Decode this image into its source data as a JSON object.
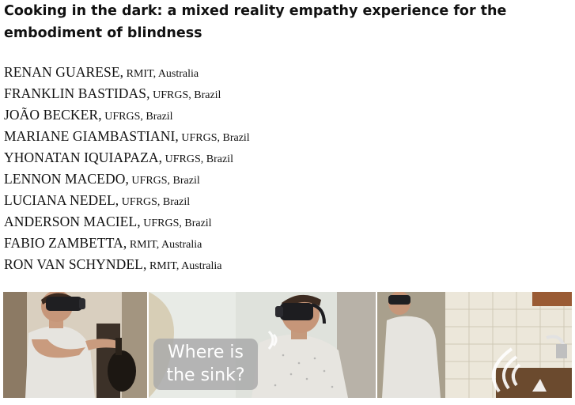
{
  "paper": {
    "title": "Cooking in the dark: a mixed reality empathy experience for the embodiment of blindness",
    "authors": [
      {
        "name": "RENAN GUARESE,",
        "affiliation": " RMIT, Australia"
      },
      {
        "name": "FRANKLIN BASTIDAS,",
        "affiliation": " UFRGS, Brazil"
      },
      {
        "name": "JOÃO BECKER,",
        "affiliation": " UFRGS, Brazil"
      },
      {
        "name": "MARIANE GIAMBASTIANI,",
        "affiliation": " UFRGS, Brazil"
      },
      {
        "name": "YHONATAN IQUIAPAZA,",
        "affiliation": " UFRGS, Brazil"
      },
      {
        "name": "LENNON MACEDO,",
        "affiliation": " UFRGS, Brazil"
      },
      {
        "name": "LUCIANA NEDEL,",
        "affiliation": " UFRGS, Brazil"
      },
      {
        "name": "ANDERSON MACIEL,",
        "affiliation": " UFRGS, Brazil"
      },
      {
        "name": "FABIO ZAMBETTA,",
        "affiliation": " RMIT, Australia"
      },
      {
        "name": "RON VAN SCHYNDEL,",
        "affiliation": " RMIT, Australia"
      }
    ]
  },
  "teaser": {
    "speech_bubble": {
      "line1": "Where is",
      "line2": "the sink?"
    }
  }
}
